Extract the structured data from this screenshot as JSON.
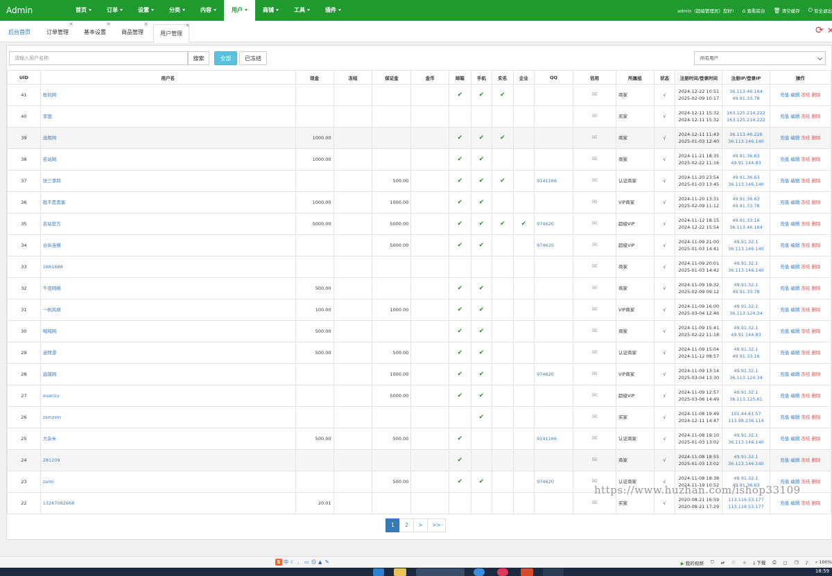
{
  "brand": "Admin",
  "nav": [
    {
      "label": "首页",
      "active": false
    },
    {
      "label": "订单",
      "active": false
    },
    {
      "label": "设置",
      "active": false
    },
    {
      "label": "分类",
      "active": false
    },
    {
      "label": "内容",
      "active": false
    },
    {
      "label": "用户",
      "active": true
    },
    {
      "label": "商铺",
      "active": false
    },
    {
      "label": "工具",
      "active": false
    },
    {
      "label": "插件",
      "active": false
    }
  ],
  "topright": {
    "greeting": "admin（超级管理员）您好!",
    "home_link": "查看前台",
    "cache_link": "清空缓存",
    "logout_link": "安全退出"
  },
  "tabs": [
    {
      "label": "后台首页",
      "closable": false
    },
    {
      "label": "订单管理",
      "closable": true
    },
    {
      "label": "基本设置",
      "closable": true
    },
    {
      "label": "商品管理",
      "closable": true
    },
    {
      "label": "用户管理",
      "closable": true,
      "active": true
    }
  ],
  "toolbar": {
    "search_placeholder": "请输入用户名称",
    "search_label": "搜索",
    "all_label": "全部",
    "frozen_label": "已冻结",
    "user_filter": "所有用户"
  },
  "columns": [
    "UID",
    "用户名",
    "现金",
    "冻结",
    "保证金",
    "金币",
    "邮箱",
    "手机",
    "实名",
    "企业",
    "QQ",
    "信用",
    "所属组",
    "状态",
    "注册时间/登录时间",
    "注册IP/登录IP",
    "操作"
  ],
  "ops": [
    "充值",
    "编辑",
    "冻结",
    "删除"
  ],
  "status_mark": "√",
  "rows": [
    {
      "uid": "41",
      "name": "抢码网",
      "cash": "",
      "frozen": "",
      "deposit": "",
      "coin": "",
      "email": true,
      "phone": true,
      "realname": true,
      "company": false,
      "qq": "",
      "group": "商家",
      "reg_time": "2024-12-22 10:51",
      "login_time": "2025-02-09 10:17",
      "reg_ip": "36.113.46.164",
      "login_ip": "49.91.33.78"
    },
    {
      "uid": "40",
      "name": "李国",
      "cash": "",
      "frozen": "",
      "deposit": "",
      "coin": "",
      "email": false,
      "phone": false,
      "realname": false,
      "company": false,
      "qq": "",
      "group": "买家",
      "reg_time": "2024-12-11 15:32",
      "login_time": "2024-12-11 15:32",
      "reg_ip": "163.125.214.222",
      "login_ip": "163.125.214.222"
    },
    {
      "uid": "39",
      "name": "选租网",
      "cash": "1000.00",
      "frozen": "",
      "deposit": "",
      "coin": "",
      "email": true,
      "phone": true,
      "realname": true,
      "company": false,
      "qq": "",
      "group": "商家",
      "reg_time": "2024-12-11 11:43",
      "login_time": "2025-01-03 12:40",
      "reg_ip": "36.113.46.226",
      "login_ip": "36.113.146.140"
    },
    {
      "uid": "38",
      "name": "名站网",
      "cash": "1000.00",
      "frozen": "",
      "deposit": "",
      "coin": "",
      "email": true,
      "phone": true,
      "realname": false,
      "company": false,
      "qq": "",
      "group": "商家",
      "reg_time": "2024-11-21 18:35",
      "login_time": "2025-02-22 11:16",
      "reg_ip": "49.91.36.63",
      "login_ip": "49.91.144.83"
    },
    {
      "uid": "37",
      "name": "张三李四",
      "cash": "",
      "frozen": "",
      "deposit": "500.00",
      "coin": "",
      "email": true,
      "phone": true,
      "realname": true,
      "company": false,
      "qq": "9141166",
      "group": "认证商家",
      "reg_time": "2024-11-20 23:54",
      "login_time": "2025-01-03 13:45",
      "reg_ip": "49.91.36.63",
      "login_ip": "36.113.146.140"
    },
    {
      "uid": "36",
      "name": "我不是黑客",
      "cash": "1000.00",
      "frozen": "",
      "deposit": "1000.00",
      "coin": "",
      "email": true,
      "phone": true,
      "realname": false,
      "company": false,
      "qq": "",
      "group": "VIP商家",
      "reg_time": "2024-11-20 13:31",
      "login_time": "2025-02-09 11:12",
      "reg_ip": "49.91.36.63",
      "login_ip": "49.91.33.78"
    },
    {
      "uid": "35",
      "name": "名站官方",
      "cash": "5000.00",
      "frozen": "",
      "deposit": "5000.00",
      "coin": "",
      "email": true,
      "phone": true,
      "realname": true,
      "company": true,
      "qq": "974620",
      "group": "超级VIP",
      "reg_time": "2024-11-12 18:15",
      "login_time": "2024-12-22 15:54",
      "reg_ip": "49.91.33.16",
      "login_ip": "36.113.46.164"
    },
    {
      "uid": "34",
      "name": "合纵连横",
      "cash": "",
      "frozen": "",
      "deposit": "5000.00",
      "coin": "",
      "email": true,
      "phone": true,
      "realname": false,
      "company": false,
      "qq": "974620",
      "group": "超级VIP",
      "reg_time": "2024-11-09 21:00",
      "login_time": "2025-01-03 14:41",
      "reg_ip": "49.91.32.1",
      "login_ip": "36.113.146.140"
    },
    {
      "uid": "33",
      "name": "1681688",
      "cash": "",
      "frozen": "",
      "deposit": "",
      "coin": "",
      "email": false,
      "phone": false,
      "realname": false,
      "company": false,
      "qq": "",
      "group": "商家",
      "reg_time": "2024-11-09 20:01",
      "login_time": "2025-01-03 14:42",
      "reg_ip": "49.91.32.1",
      "login_ip": "36.113.146.140"
    },
    {
      "uid": "32",
      "name": "千佰网络",
      "cash": "500.00",
      "frozen": "",
      "deposit": "",
      "coin": "",
      "email": true,
      "phone": true,
      "realname": false,
      "company": false,
      "qq": "",
      "group": "商家",
      "reg_time": "2024-11-09 19:32",
      "login_time": "2025-02-09 09:12",
      "reg_ip": "49.91.32.1",
      "login_ip": "49.91.33.78"
    },
    {
      "uid": "31",
      "name": "一帆风顺",
      "cash": "100.00",
      "frozen": "",
      "deposit": "1000.00",
      "coin": "",
      "email": true,
      "phone": true,
      "realname": false,
      "company": false,
      "qq": "",
      "group": "VIP商家",
      "reg_time": "2024-11-09 16:00",
      "login_time": "2025-03-04 12:46",
      "reg_ip": "49.91.32.1",
      "login_ip": "36.113.124.34"
    },
    {
      "uid": "30",
      "name": "喊喊网",
      "cash": "500.00",
      "frozen": "",
      "deposit": "",
      "coin": "",
      "email": true,
      "phone": true,
      "realname": false,
      "company": false,
      "qq": "",
      "group": "商家",
      "reg_time": "2024-11-09 15:41",
      "login_time": "2025-02-22 11:18",
      "reg_ip": "49.91.32.1",
      "login_ip": "49.91.144.83"
    },
    {
      "uid": "29",
      "name": "迪拜游",
      "cash": "500.00",
      "frozen": "",
      "deposit": "500.00",
      "coin": "",
      "email": true,
      "phone": true,
      "realname": false,
      "company": false,
      "qq": "",
      "group": "认证商家",
      "reg_time": "2024-11-09 15:04",
      "login_time": "2024-11-12 08:57",
      "reg_ip": "49.91.32.1",
      "login_ip": "49.91.33.16"
    },
    {
      "uid": "28",
      "name": "选铺网",
      "cash": "",
      "frozen": "",
      "deposit": "1000.00",
      "coin": "",
      "email": true,
      "phone": true,
      "realname": false,
      "company": false,
      "qq": "974620",
      "group": "VIP商家",
      "reg_time": "2024-11-09 13:14",
      "login_time": "2025-03-04 13:30",
      "reg_ip": "49.91.32.1",
      "login_ip": "36.113.124.34"
    },
    {
      "uid": "27",
      "name": "xuanzu",
      "cash": "",
      "frozen": "",
      "deposit": "5000.00",
      "coin": "",
      "email": true,
      "phone": true,
      "realname": false,
      "company": false,
      "qq": "",
      "group": "超级VIP",
      "reg_time": "2024-11-09 12:57",
      "login_time": "2025-03-06 14:49",
      "reg_ip": "49.91.32.1",
      "login_ip": "36.113.125.61"
    },
    {
      "uid": "26",
      "name": "zsmzsm",
      "cash": "",
      "frozen": "",
      "deposit": "",
      "coin": "",
      "email": false,
      "phone": true,
      "realname": false,
      "company": false,
      "qq": "",
      "group": "买家",
      "reg_time": "2024-11-08 19:49",
      "login_time": "2024-12-11 14:47",
      "reg_ip": "101.44.81.57",
      "login_ip": "113.98.236.114"
    },
    {
      "uid": "25",
      "name": "大杂米",
      "cash": "500.00",
      "frozen": "",
      "deposit": "500.00",
      "coin": "",
      "email": true,
      "phone": false,
      "realname": false,
      "company": false,
      "qq": "9141166",
      "group": "认证商家",
      "reg_time": "2024-11-08 19:10",
      "login_time": "2025-01-03 13:02",
      "reg_ip": "49.91.32.1",
      "login_ip": "36.113.146.140"
    },
    {
      "uid": "24",
      "name": "281209",
      "cash": "",
      "frozen": "",
      "deposit": "",
      "coin": "",
      "email": true,
      "phone": false,
      "realname": false,
      "company": false,
      "qq": "",
      "group": "商家",
      "reg_time": "2024-11-08 18:55",
      "login_time": "2025-01-03 13:02",
      "reg_ip": "49.91.32.1",
      "login_ip": "36.113.146.140"
    },
    {
      "uid": "23",
      "name": "zami",
      "cash": "",
      "frozen": "",
      "deposit": "500.00",
      "coin": "",
      "email": true,
      "phone": true,
      "realname": false,
      "company": false,
      "qq": "974620",
      "group": "认证商家",
      "reg_time": "2024-11-08 18:38",
      "login_time": "2024-11-19 10:52",
      "reg_ip": "49.91.32.1",
      "login_ip": "49.91.36.63"
    },
    {
      "uid": "22",
      "name": "13267082668",
      "cash": "20.01",
      "frozen": "",
      "deposit": "",
      "coin": "",
      "email": false,
      "phone": false,
      "realname": false,
      "company": false,
      "qq": "",
      "group": "买家",
      "reg_time": "2020-08-21 16:59",
      "login_time": "2020-08-21 17:29",
      "reg_ip": "113.116.53.177",
      "login_ip": "113.116.53.177"
    }
  ],
  "pager": [
    {
      "label": "1",
      "current": true
    },
    {
      "label": "2",
      "current": false
    },
    {
      "label": ">",
      "current": false
    },
    {
      "label": ">>",
      "current": false
    }
  ],
  "watermark": "https://www.huzhan.com/ishop33109",
  "statusbar": {
    "video": "我的视频",
    "download": "下载",
    "zoom": "100%"
  },
  "clock": "18:59",
  "colors": {
    "topbar": "#1e9a2e",
    "link": "#3a7cc2",
    "danger": "#d9534f",
    "check": "#2a8a2a",
    "info": "#5bc0de"
  }
}
